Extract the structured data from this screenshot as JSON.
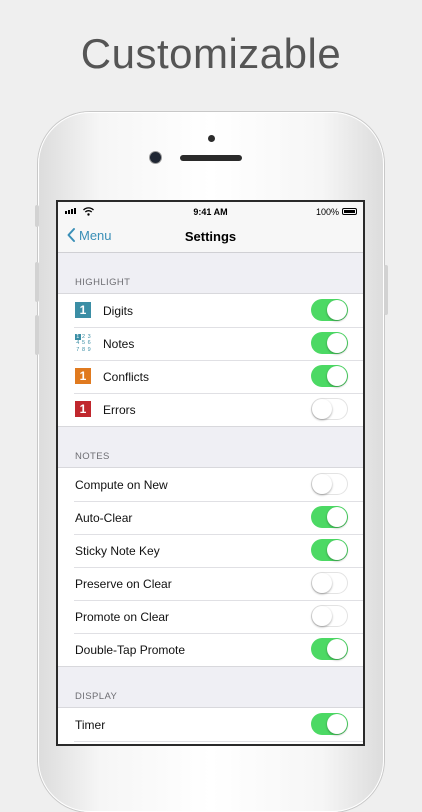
{
  "headline": "Customizable",
  "status_bar": {
    "time": "9:41 AM",
    "battery": "100%"
  },
  "nav": {
    "back_label": "Menu",
    "title": "Settings"
  },
  "colors": {
    "digits_tile": "#3b8ea5",
    "conflicts_tile": "#e07a1f",
    "errors_tile": "#c0272d",
    "toggle_on": "#4cd964",
    "link": "#3a8fb7"
  },
  "sections": {
    "highlight": {
      "header": "HIGHLIGHT",
      "rows": [
        {
          "label": "Digits",
          "icon": "digit-tile-icon",
          "icon_text": "1",
          "on": true
        },
        {
          "label": "Notes",
          "icon": "notes-grid-icon",
          "icon_text": [
            "1",
            "2",
            "3",
            "4",
            "5",
            "6",
            "7",
            "8",
            "9"
          ],
          "on": true
        },
        {
          "label": "Conflicts",
          "icon": "conflict-tile-icon",
          "icon_text": "1",
          "on": true
        },
        {
          "label": "Errors",
          "icon": "error-tile-icon",
          "icon_text": "1",
          "on": false
        }
      ]
    },
    "notes": {
      "header": "NOTES",
      "rows": [
        {
          "label": "Compute on New",
          "on": false
        },
        {
          "label": "Auto-Clear",
          "on": true
        },
        {
          "label": "Sticky Note Key",
          "on": true
        },
        {
          "label": "Preserve on Clear",
          "on": false
        },
        {
          "label": "Promote on Clear",
          "on": false
        },
        {
          "label": "Double-Tap Promote",
          "on": true
        }
      ]
    },
    "display": {
      "header": "DISPLAY",
      "rows": [
        {
          "label": "Timer",
          "on": true
        },
        {
          "label": "",
          "on": true
        }
      ]
    }
  }
}
